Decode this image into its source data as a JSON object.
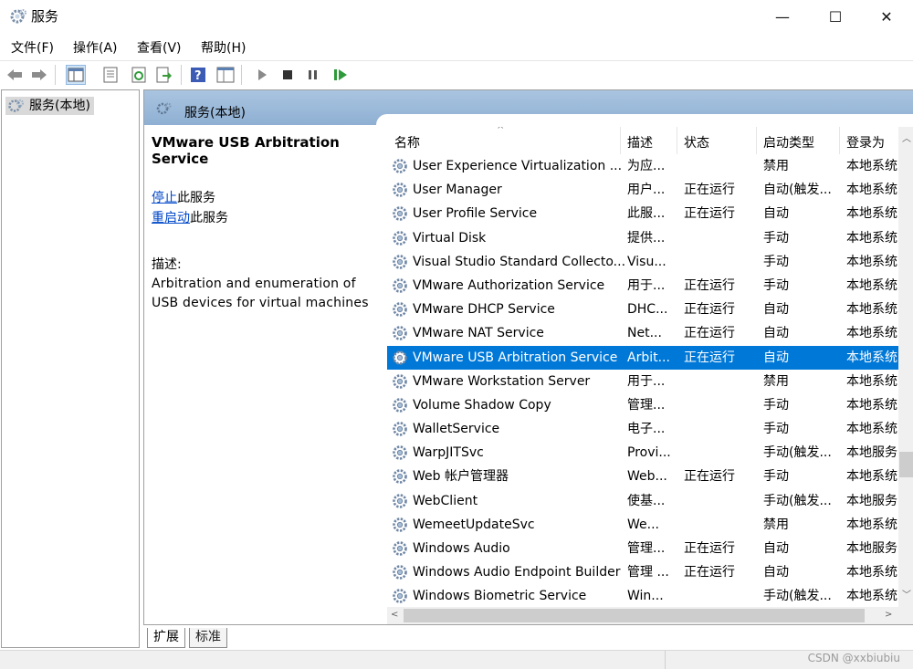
{
  "window": {
    "title": "服务",
    "controls": {
      "minimize": "—",
      "maximize": "☐",
      "close": "✕"
    }
  },
  "menu": [
    "文件(F)",
    "操作(A)",
    "查看(V)",
    "帮助(H)"
  ],
  "toolbar_icons": [
    "back-icon",
    "forward-icon",
    "show-tree-icon",
    "properties-icon",
    "refresh-icon",
    "export-icon",
    "help-icon",
    "console-icon",
    "start-icon",
    "stop-icon",
    "pause-icon",
    "resume-icon"
  ],
  "tree": {
    "root": "服务(本地)"
  },
  "panel": {
    "header": "服务(本地)",
    "selected_service": "VMware USB Arbitration Service",
    "actions": [
      {
        "link": "停止",
        "rest": "此服务"
      },
      {
        "link": "重启动",
        "rest": "此服务"
      }
    ],
    "description_label": "描述:",
    "description": "Arbitration and enumeration of USB devices for virtual machines"
  },
  "table": {
    "columns": [
      "名称",
      "描述",
      "状态",
      "启动类型",
      "登录为"
    ],
    "rows": [
      {
        "name": "User Experience Virtualization ...",
        "desc": "为应...",
        "state": "",
        "start": "禁用",
        "logon": "本地系统"
      },
      {
        "name": "User Manager",
        "desc": "用户...",
        "state": "正在运行",
        "start": "自动(触发...",
        "logon": "本地系统"
      },
      {
        "name": "User Profile Service",
        "desc": "此服...",
        "state": "正在运行",
        "start": "自动",
        "logon": "本地系统"
      },
      {
        "name": "Virtual Disk",
        "desc": "提供...",
        "state": "",
        "start": "手动",
        "logon": "本地系统"
      },
      {
        "name": "Visual Studio Standard Collecto...",
        "desc": "Visu...",
        "state": "",
        "start": "手动",
        "logon": "本地系统"
      },
      {
        "name": "VMware Authorization Service",
        "desc": "用于...",
        "state": "正在运行",
        "start": "手动",
        "logon": "本地系统"
      },
      {
        "name": "VMware DHCP Service",
        "desc": "DHC...",
        "state": "正在运行",
        "start": "自动",
        "logon": "本地系统"
      },
      {
        "name": "VMware NAT Service",
        "desc": "Net...",
        "state": "正在运行",
        "start": "自动",
        "logon": "本地系统"
      },
      {
        "name": "VMware USB Arbitration Service",
        "desc": "Arbit...",
        "state": "正在运行",
        "start": "自动",
        "logon": "本地系统",
        "selected": true
      },
      {
        "name": "VMware Workstation Server",
        "desc": "用于...",
        "state": "",
        "start": "禁用",
        "logon": "本地系统"
      },
      {
        "name": "Volume Shadow Copy",
        "desc": "管理...",
        "state": "",
        "start": "手动",
        "logon": "本地系统"
      },
      {
        "name": "WalletService",
        "desc": "电子...",
        "state": "",
        "start": "手动",
        "logon": "本地系统"
      },
      {
        "name": "WarpJITSvc",
        "desc": "Provi...",
        "state": "",
        "start": "手动(触发...",
        "logon": "本地服务"
      },
      {
        "name": "Web 帐户管理器",
        "desc": "Web...",
        "state": "正在运行",
        "start": "手动",
        "logon": "本地系统"
      },
      {
        "name": "WebClient",
        "desc": "使基...",
        "state": "",
        "start": "手动(触发...",
        "logon": "本地服务"
      },
      {
        "name": "WemeetUpdateSvc",
        "desc": "We...",
        "state": "",
        "start": "禁用",
        "logon": "本地系统"
      },
      {
        "name": "Windows Audio",
        "desc": "管理...",
        "state": "正在运行",
        "start": "自动",
        "logon": "本地服务"
      },
      {
        "name": "Windows Audio Endpoint Builder",
        "desc": "管理 ...",
        "state": "正在运行",
        "start": "自动",
        "logon": "本地系统"
      },
      {
        "name": "Windows Biometric Service",
        "desc": "Win...",
        "state": "",
        "start": "手动(触发...",
        "logon": "本地系统"
      }
    ]
  },
  "tabs": [
    "扩展",
    "标准"
  ],
  "watermark": "CSDN @xxbiubiu",
  "colors": {
    "selection": "#0078d7",
    "header": "#99b9db",
    "link": "#0047c8"
  }
}
